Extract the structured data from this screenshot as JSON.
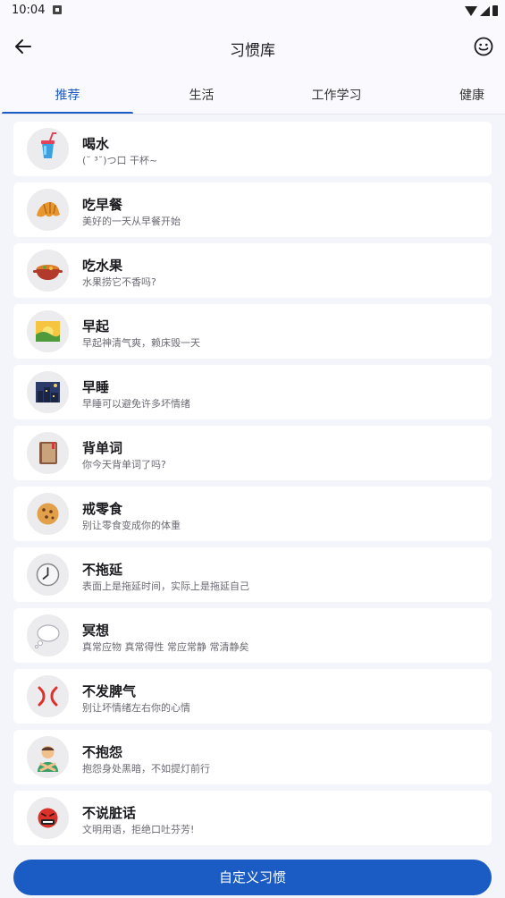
{
  "status_bar": {
    "time": "10:04"
  },
  "app_bar": {
    "title": "习惯库",
    "back_icon": "arrow-left-icon",
    "action_icon": "smiley-icon"
  },
  "tabs": [
    {
      "label": "推荐",
      "selected": true
    },
    {
      "label": "生活",
      "selected": false
    },
    {
      "label": "工作学习",
      "selected": false
    },
    {
      "label": "健康",
      "selected": false
    }
  ],
  "colors": {
    "accent": "#1a5bc4",
    "background": "#f4f5fa",
    "card": "#ffffff"
  },
  "habits": [
    {
      "title": "喝水",
      "subtitle": "(˘ ³˘)つ口 干杯~",
      "icon": "cup-with-straw-icon"
    },
    {
      "title": "吃早餐",
      "subtitle": "美好的一天从早餐开始",
      "icon": "croissant-icon"
    },
    {
      "title": "吃水果",
      "subtitle": "水果捞它不香吗?",
      "icon": "pot-of-food-icon"
    },
    {
      "title": "早起",
      "subtitle": "早起神清气爽，赖床毁一天",
      "icon": "sunrise-icon"
    },
    {
      "title": "早睡",
      "subtitle": "早睡可以避免许多坏情绪",
      "icon": "night-city-icon"
    },
    {
      "title": "背单词",
      "subtitle": "你今天背单词了吗?",
      "icon": "notebook-icon"
    },
    {
      "title": "戒零食",
      "subtitle": "别让零食变成你的体重",
      "icon": "cookie-icon"
    },
    {
      "title": "不拖延",
      "subtitle": "表面上是拖延时间，实际上是拖延自己",
      "icon": "clock-icon"
    },
    {
      "title": "冥想",
      "subtitle": "真常应物 真常得性 常应常静 常清静矣",
      "icon": "thought-balloon-icon"
    },
    {
      "title": "不发脾气",
      "subtitle": "别让坏情绪左右你的心情",
      "icon": "anger-symbol-icon"
    },
    {
      "title": "不抱怨",
      "subtitle": "抱怨身处黑暗，不如提灯前行",
      "icon": "person-gesturing-no-icon"
    },
    {
      "title": "不说脏话",
      "subtitle": "文明用语，拒绝口吐芬芳!",
      "icon": "face-with-symbols-icon"
    }
  ],
  "custom_button": {
    "label": "自定义习惯"
  }
}
